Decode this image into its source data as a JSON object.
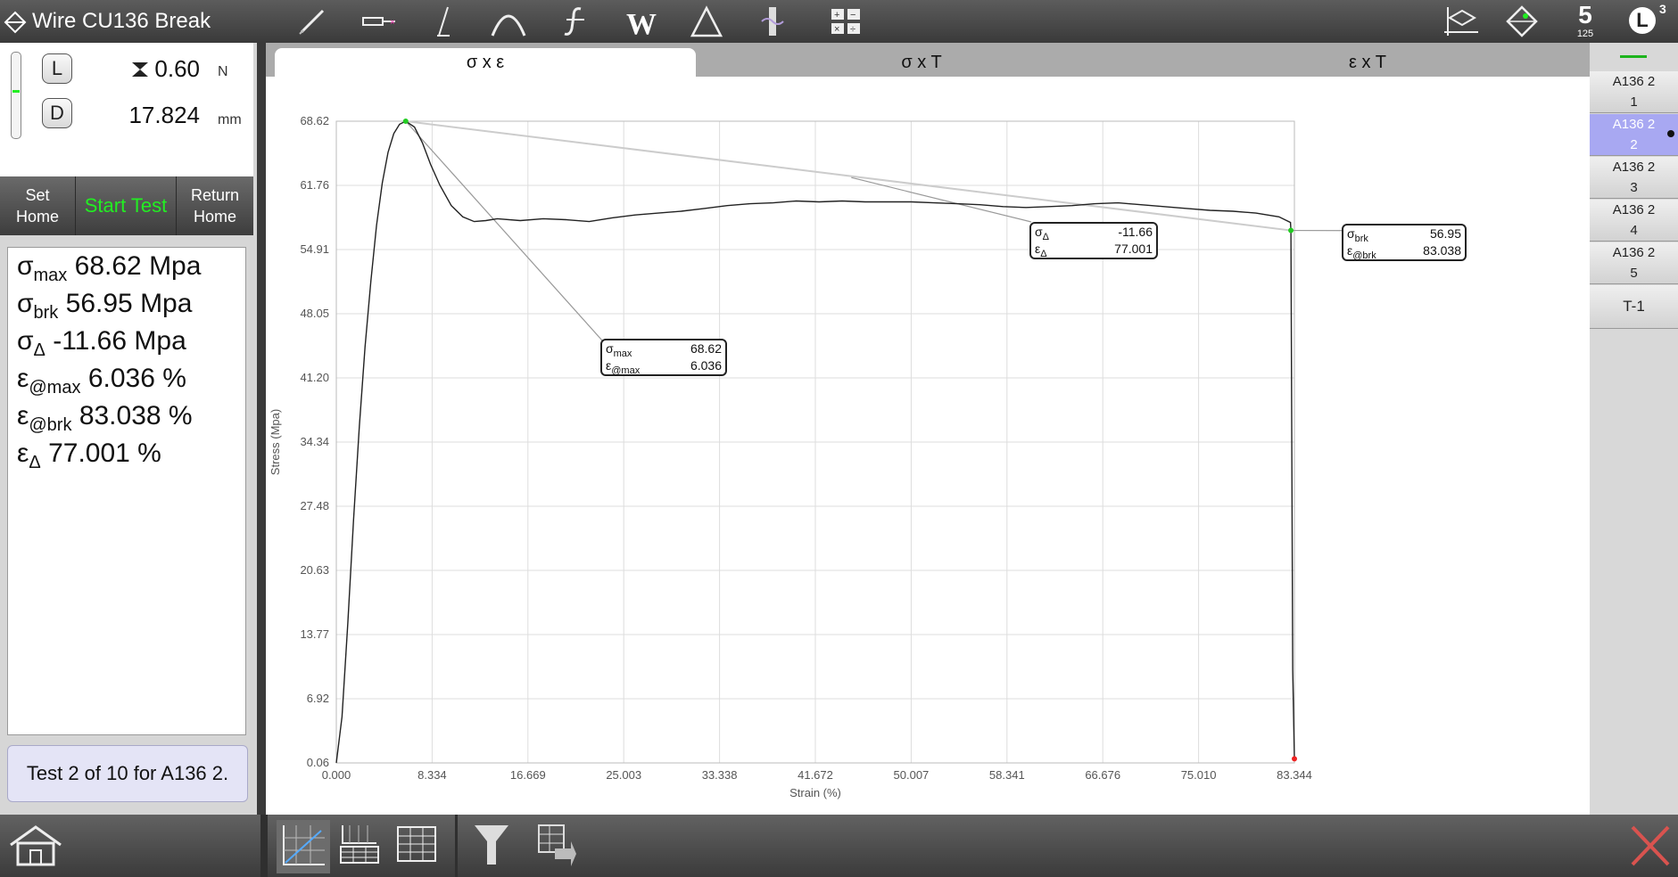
{
  "window": {
    "title": "Wire CU136 Break"
  },
  "toolbar": {
    "icons": [
      "pen-icon",
      "probe-icon",
      "slope-icon",
      "curve-icon",
      "integral-icon",
      "w-icon",
      "triangle-icon",
      "cut-icon",
      "calculator-icon",
      "baseline-icon",
      "diamond-icon",
      "speed-icon",
      "l-badge-icon"
    ],
    "speed_value": "125",
    "l_badge_count": "3"
  },
  "readouts": {
    "load_button": "L",
    "load_value": "0.60",
    "load_unit": "N",
    "disp_button": "D",
    "disp_value": "17.824",
    "disp_unit": "mm"
  },
  "commands": {
    "set_home": [
      "Set",
      "Home"
    ],
    "start_test": "Start Test",
    "return_home": [
      "Return",
      "Home"
    ]
  },
  "results": [
    {
      "sym": "σ",
      "sub": "max",
      "value": "68.62 Mpa"
    },
    {
      "sym": "σ",
      "sub": "brk",
      "value": "56.95 Mpa"
    },
    {
      "sym": "σ",
      "sub": "Δ",
      "value": "-11.66 Mpa"
    },
    {
      "sym": "ε",
      "sub": "@max",
      "value": "6.036 %"
    },
    {
      "sym": "ε",
      "sub": "@brk",
      "value": "83.038 %"
    },
    {
      "sym": "ε",
      "sub": "Δ",
      "value": "77.001 %"
    }
  ],
  "status_message": "Test 2 of 10 for A136 2.",
  "tabs": [
    "σ x ε",
    "σ x T",
    "ε x T"
  ],
  "specimens": [
    {
      "label": "A136 2",
      "index": "1",
      "selected": false
    },
    {
      "label": "A136 2",
      "index": "2",
      "selected": true
    },
    {
      "label": "A136 2",
      "index": "3",
      "selected": false
    },
    {
      "label": "A136 2",
      "index": "4",
      "selected": false
    },
    {
      "label": "A136 2",
      "index": "5",
      "selected": false
    }
  ],
  "template_label": "T-1",
  "annotations": {
    "max": {
      "s_label": "σ",
      "s_sub": "max",
      "s_value": "68.62",
      "e_label": "ε",
      "e_sub": "@max",
      "e_value": "6.036"
    },
    "delta": {
      "s_label": "σ",
      "s_sub": "Δ",
      "s_value": "-11.66",
      "e_label": "ε",
      "e_sub": "Δ",
      "e_value": "77.001"
    },
    "brk": {
      "s_label": "σ",
      "s_sub": "brk",
      "s_value": "56.95",
      "e_label": "ε",
      "e_sub": "@brk",
      "e_value": "83.038"
    }
  },
  "bottom": {
    "icons": [
      "home-icon",
      "graph-view-icon",
      "graph-table-view-icon",
      "table-view-icon",
      "funnel-icon",
      "export-icon",
      "close-icon"
    ]
  },
  "colors": {
    "accent_green": "#22ee22",
    "selected_specimen": "#a8a8f2",
    "close_red": "#d9534f"
  },
  "chart_data": {
    "type": "line",
    "xlabel": "Strain (%)",
    "ylabel": "Stress (Mpa)",
    "xlim": [
      0.0,
      83.344
    ],
    "ylim": [
      0.06,
      68.62
    ],
    "x_ticks": [
      "0.000",
      "8.334",
      "16.669",
      "25.003",
      "33.338",
      "41.672",
      "50.007",
      "58.341",
      "66.676",
      "75.010",
      "83.344"
    ],
    "y_ticks": [
      "0.06",
      "6.92",
      "13.77",
      "20.63",
      "27.48",
      "34.34",
      "41.20",
      "48.05",
      "54.91",
      "61.76",
      "68.62"
    ],
    "grid": true,
    "series": [
      {
        "x": [
          0.0,
          0.5,
          1.0,
          1.5,
          2.0,
          2.5,
          3.0,
          3.5,
          4.0,
          4.5,
          5.0,
          5.5,
          6.036,
          6.8,
          7.5,
          8.2,
          9.0,
          10.0,
          11.0,
          12.0,
          13.0,
          14.0,
          16.0,
          18.0,
          20.0,
          22.0,
          24.0,
          26.0,
          28.0,
          30.0,
          32.0,
          34.0,
          36.0,
          38.0,
          40.0,
          42.0,
          44.0,
          46.0,
          48.0,
          50.0,
          52.0,
          54.0,
          56.0,
          58.0,
          60.0,
          62.0,
          64.0,
          66.0,
          68.0,
          70.0,
          72.0,
          74.0,
          76.0,
          78.0,
          80.0,
          82.0,
          83.0,
          83.038,
          83.2,
          83.344
        ],
        "y": [
          0.06,
          5.0,
          15.0,
          26.0,
          36.0,
          44.5,
          51.5,
          57.5,
          62.0,
          65.3,
          67.3,
          68.3,
          68.62,
          68.0,
          66.3,
          64.0,
          61.8,
          59.6,
          58.4,
          57.9,
          58.0,
          58.2,
          58.0,
          58.2,
          58.1,
          57.9,
          58.3,
          58.6,
          58.8,
          59.0,
          59.3,
          59.6,
          59.8,
          59.9,
          60.1,
          60.0,
          60.1,
          60.0,
          60.0,
          60.0,
          59.9,
          59.8,
          59.7,
          59.5,
          59.4,
          59.5,
          59.6,
          59.8,
          59.9,
          59.7,
          59.5,
          59.3,
          59.1,
          59.0,
          58.8,
          58.4,
          57.8,
          56.95,
          10.0,
          0.5
        ]
      }
    ],
    "trend_line": {
      "x": [
        6.036,
        83.038
      ],
      "y": [
        68.62,
        56.95
      ]
    }
  }
}
